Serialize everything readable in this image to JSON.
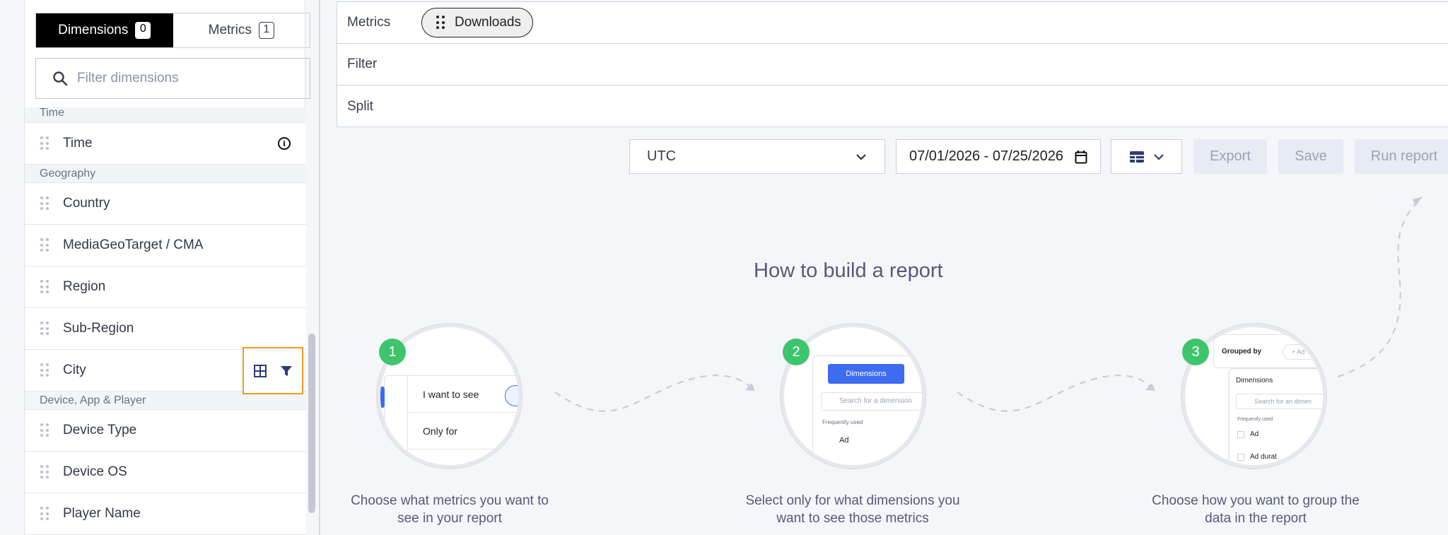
{
  "sidebar": {
    "tabs": [
      {
        "label": "Dimensions",
        "count": "0"
      },
      {
        "label": "Metrics",
        "count": "1"
      }
    ],
    "filter_placeholder": "Filter dimensions",
    "groups": {
      "time": {
        "label": "Time",
        "items": [
          "Time"
        ]
      },
      "geography": {
        "label": "Geography",
        "items": [
          "Country",
          "MediaGeoTarget / CMA",
          "Region",
          "Sub-Region",
          "City"
        ]
      },
      "device": {
        "label": "Device, App & Player",
        "items": [
          "Device Type",
          "Device OS",
          "Player Name"
        ]
      }
    }
  },
  "builder": {
    "metrics_label": "Metrics",
    "metric_pill": "Downloads",
    "filter_label": "Filter",
    "split_label": "Split"
  },
  "toolbar": {
    "timezone": "UTC",
    "date_range": "07/01/2026 - 07/25/2026",
    "export": "Export",
    "save": "Save",
    "run": "Run report"
  },
  "guide": {
    "title": "How to build a report",
    "steps": [
      {
        "num": "1",
        "caption_line1": "Choose what metrics you want to",
        "caption_line2": "see in your report",
        "mock": {
          "row1": "I want to see",
          "row2": "Only for"
        }
      },
      {
        "num": "2",
        "caption_line1": "Select only for what dimensions you",
        "caption_line2": "want to see those metrics",
        "mock": {
          "button": "Dimensions",
          "search": "Search for a dimension",
          "section": "Frequently used",
          "item": "Ad"
        }
      },
      {
        "num": "3",
        "caption_line1": "Choose how you want to group the",
        "caption_line2": "data in the report",
        "mock": {
          "grouped": "Grouped by",
          "add": "+ Ad",
          "title": "Dimensions",
          "search": "Search for an dimen",
          "section": "Frequently used",
          "item1": "Ad",
          "item2": "Ad durat"
        }
      }
    ]
  },
  "colors": {
    "accent_green": "#3ec46d",
    "highlight_orange": "#f29a1e",
    "primary_blue": "#3d6cf0"
  }
}
